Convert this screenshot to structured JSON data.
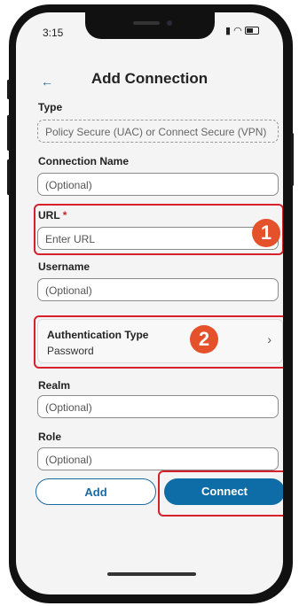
{
  "status": {
    "time": "3:15"
  },
  "header": {
    "title": "Add Connection",
    "back_icon": "←"
  },
  "type": {
    "label": "Type",
    "value": "Policy Secure (UAC) or Connect Secure (VPN)"
  },
  "connection_name": {
    "label": "Connection Name",
    "placeholder": "(Optional)"
  },
  "url": {
    "label": "URL",
    "required_mark": "*",
    "placeholder": "Enter URL"
  },
  "username": {
    "label": "Username",
    "placeholder": "(Optional)"
  },
  "auth": {
    "title": "Authentication Type",
    "value": "Password",
    "chevron": "›"
  },
  "realm": {
    "label": "Realm",
    "placeholder": "(Optional)"
  },
  "role": {
    "label": "Role",
    "placeholder": "(Optional)"
  },
  "buttons": {
    "add": "Add",
    "connect": "Connect"
  },
  "annotations": {
    "badge1": "1",
    "badge2": "2",
    "highlight_color": "#d6202a",
    "badge_color": "#e5512b"
  },
  "colors": {
    "accent": "#0e6da6"
  }
}
